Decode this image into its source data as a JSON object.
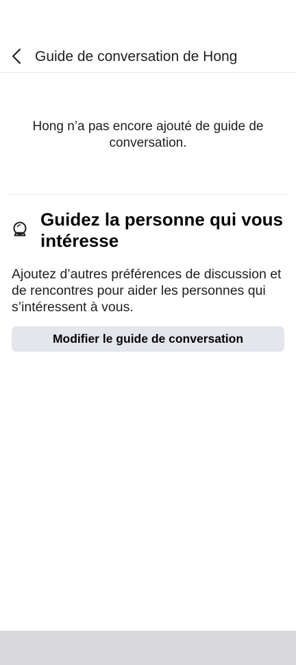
{
  "header": {
    "back_icon": "chevron-left-icon",
    "title": "Guide de conversation de Hong"
  },
  "empty_state": {
    "message": "Hong n’a pas encore ajouté de guide de conversation."
  },
  "guide_section": {
    "icon": "crystal-ball-icon",
    "title": "Guidez la personne qui vous intéresse",
    "description": "Ajoutez d’autres préférences de discussion et de rencontres pour aider les personnes qui s’intéressent à vous.",
    "button_label": "Modifier le guide de conversation"
  },
  "colors": {
    "text_primary": "#1c1e21",
    "divider": "#e4e6eb",
    "button_bg": "#e4e6eb",
    "bottom_bar": "#dadadc"
  }
}
